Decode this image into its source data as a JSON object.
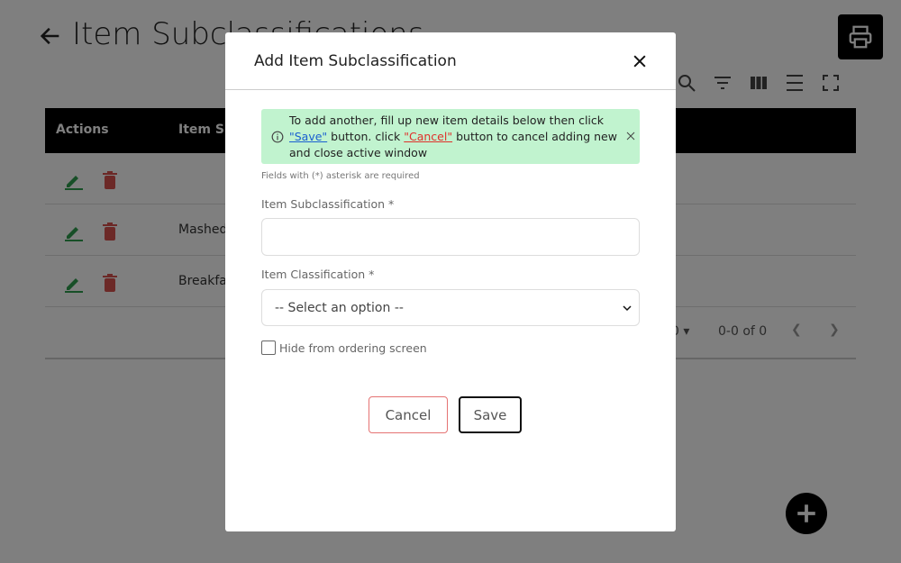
{
  "page": {
    "title": "Item Subclassifications",
    "table": {
      "headers": [
        "Actions",
        "Item Su"
      ],
      "rows": [
        {
          "name": ""
        },
        {
          "name": "Mashed"
        },
        {
          "name": "Breakfa"
        }
      ]
    },
    "pager": {
      "per_page": "0",
      "range": "0-0 of 0"
    }
  },
  "modal": {
    "title": "Add Item Subclassification",
    "alert": {
      "text_1": "To add another, fill up new item details below then click ",
      "save_link": "\"Save\"",
      "text_2": " button. click ",
      "cancel_link": "\"Cancel\"",
      "text_3": " button to cancel adding new and close active window"
    },
    "required_hint": "Fields with (*) asterisk are required",
    "subclassification_label": "Item Subclassification *",
    "subclassification_value": "",
    "classification_label": "Item Classification *",
    "classification_value": "-- Select an option --",
    "hide_label": "Hide from ordering screen",
    "cancel_label": "Cancel",
    "save_label": "Save"
  },
  "colors": {
    "alert_bg": "#c1f3cf",
    "edit_green": "#2e9e4f",
    "delete_red": "#d9534f",
    "cancel_border": "#e57373"
  }
}
